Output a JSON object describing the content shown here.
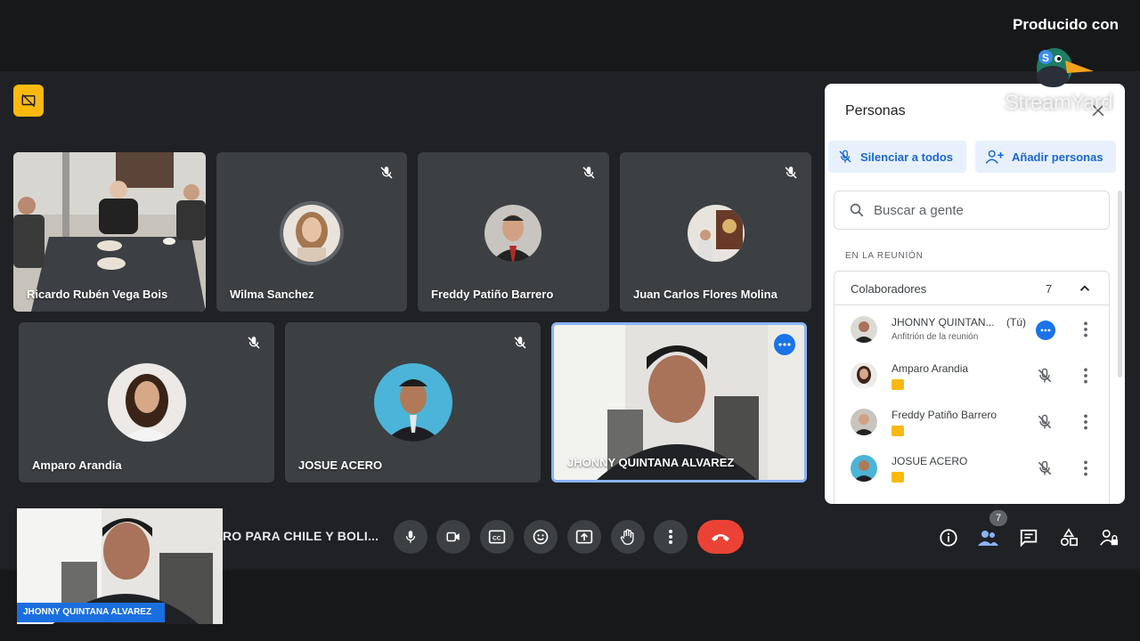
{
  "branding": {
    "produced_with": "Producido con",
    "brand_name": "StreamYard"
  },
  "tiles": [
    {
      "name": "Ricardo Rubén Vega Bois"
    },
    {
      "name": "Wilma Sanchez"
    },
    {
      "name": "Freddy Patiño Barrero"
    },
    {
      "name": "Juan Carlos Flores Molina"
    },
    {
      "name": "Amparo Arandia"
    },
    {
      "name": "JOSUE ACERO"
    },
    {
      "name": "JHONNY QUINTANA ALVAREZ"
    }
  ],
  "meeting": {
    "title": "RO PARA CHILE Y BOLI..."
  },
  "selfview": {
    "name": "JHONNY QUINTANA ALVAREZ"
  },
  "toolbar": {
    "participant_count": "7"
  },
  "panel": {
    "title": "Personas",
    "mute_all": "Silenciar a todos",
    "add_people": "Añadir personas",
    "search_placeholder": "Buscar a gente",
    "section_label": "EN LA REUNIÓN",
    "group_label": "Colaboradores",
    "group_count": "7",
    "people": [
      {
        "name": "JHONNY QUINTAN...",
        "tag": "(Tú)",
        "role": "Anfitrión de la reunión"
      },
      {
        "name": "Amparo Arandia"
      },
      {
        "name": "Freddy Patiño Barrero"
      },
      {
        "name": "JOSUE ACERO"
      }
    ]
  },
  "colors": {
    "accent": "#1a73e8",
    "hangup": "#ea4335",
    "tile_bg": "#3c4043",
    "yellow_badge": "#f9b910"
  }
}
